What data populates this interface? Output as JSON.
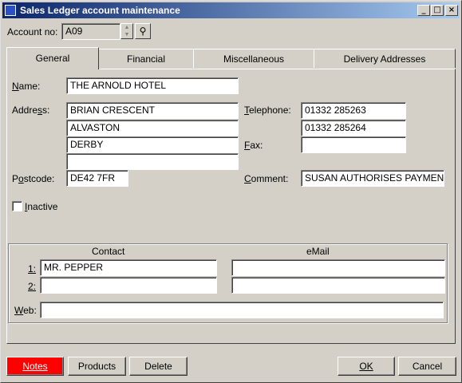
{
  "window": {
    "title": "Sales Ledger account maintenance",
    "minimize_glyph": "_",
    "maximize_glyph": "□",
    "close_glyph": "×"
  },
  "account": {
    "label": "Account no:",
    "value": "A09",
    "spin_up": "▲",
    "spin_down": "▼",
    "search_glyph": "⚲"
  },
  "tabs": [
    {
      "label": "General",
      "active": true
    },
    {
      "label": "Financial"
    },
    {
      "label": "Miscellaneous"
    },
    {
      "label": "Delivery Addresses"
    }
  ],
  "general": {
    "name_label": "Name:",
    "name_value": "THE ARNOLD HOTEL",
    "address_label": "Address:",
    "address_lines": [
      "BRIAN CRESCENT",
      "ALVASTON",
      "DERBY",
      ""
    ],
    "postcode_label": "Postcode:",
    "postcode_value": "DE42 7FR",
    "telephone_label": "Telephone:",
    "telephone_values": [
      "01332 285263",
      "01332 285264"
    ],
    "fax_label": "Fax:",
    "fax_value": "",
    "comment_label": "Comment:",
    "comment_value": "SUSAN AUTHORISES PAYMENT",
    "inactive_label": "Inactive",
    "inactive_checked": false
  },
  "contacts": {
    "contact_header": "Contact",
    "email_header": "eMail",
    "rows": [
      {
        "num": "1:",
        "contact": "MR. PEPPER",
        "email": ""
      },
      {
        "num": "2:",
        "contact": "",
        "email": ""
      }
    ],
    "web_label": "Web:",
    "web_value": ""
  },
  "buttons": {
    "notes": "Notes",
    "products": "Products",
    "delete": "Delete",
    "ok": "OK",
    "cancel": "Cancel"
  },
  "colors": {
    "face": "#d4d0c8",
    "title_start": "#0a246a",
    "title_end": "#a6caf0",
    "notes_button": "#ff0000"
  }
}
